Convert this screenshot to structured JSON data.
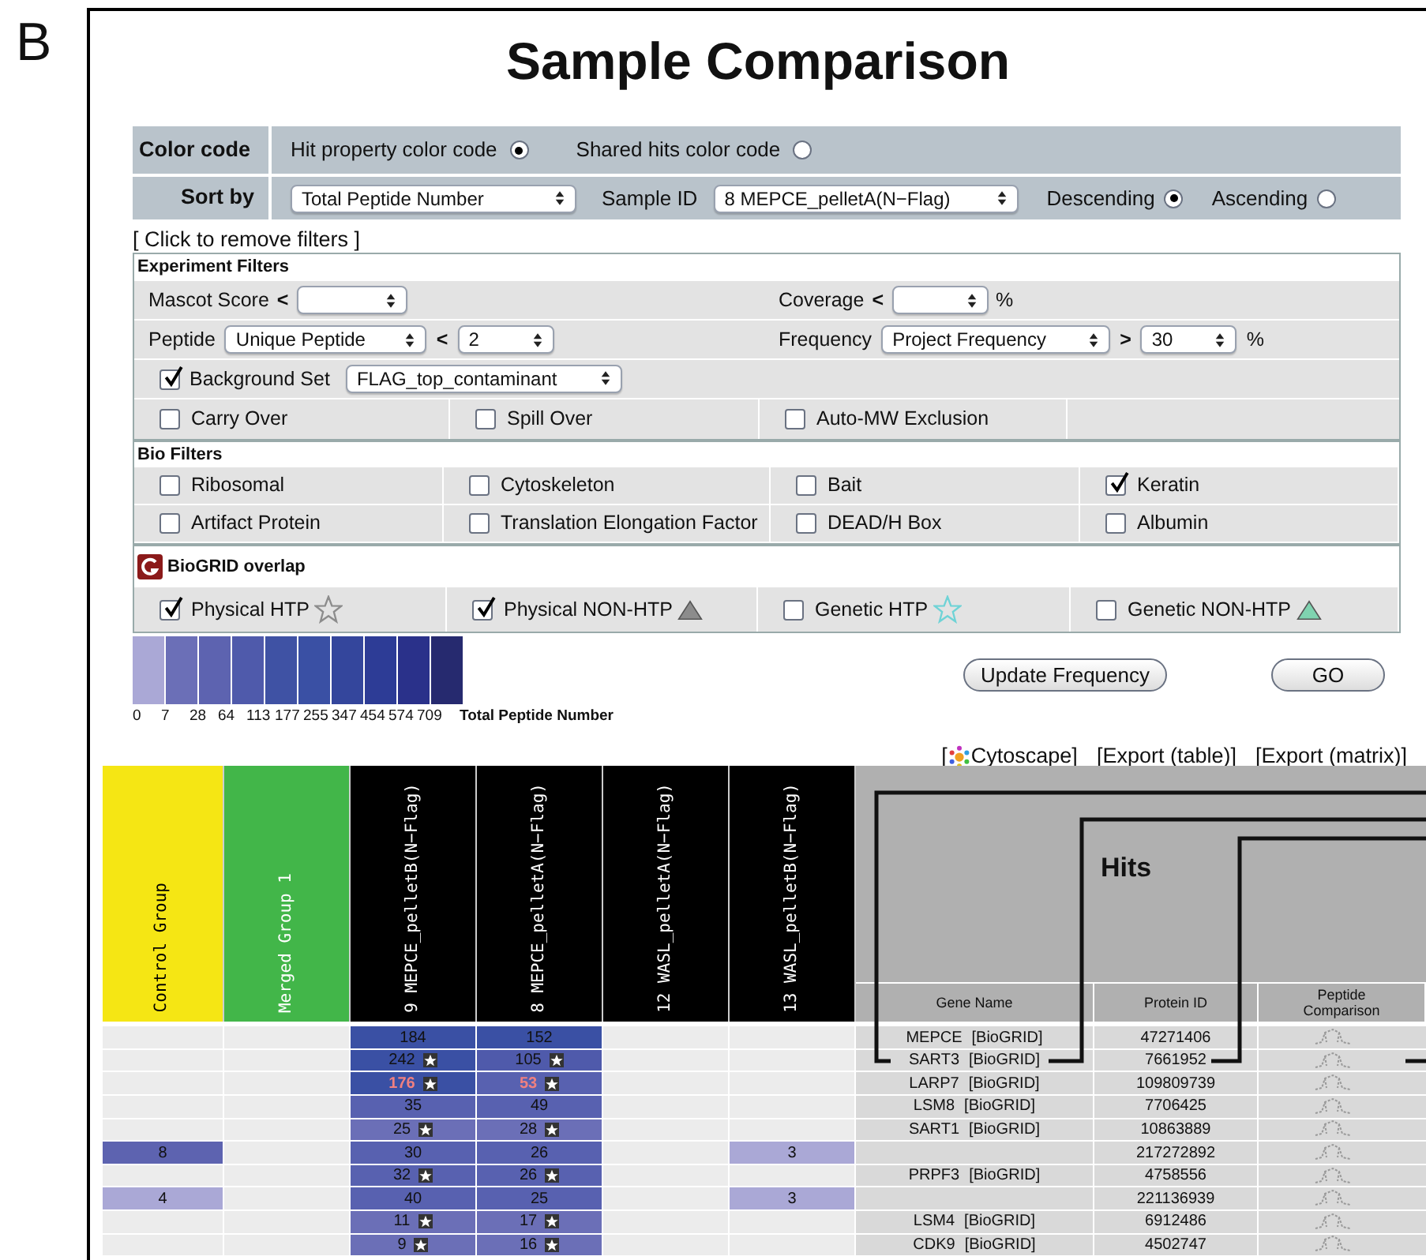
{
  "panel_label": "B",
  "title": "Sample Comparison",
  "color_code": {
    "label": "Color code",
    "options": [
      {
        "label": "Hit property color code",
        "selected": true
      },
      {
        "label": "Shared hits color code",
        "selected": false
      }
    ]
  },
  "sort_by": {
    "label": "Sort by",
    "field": "Total Peptide Number",
    "sample_label": "Sample ID",
    "sample": "8  MEPCE_pelletA(N−Flag)",
    "orders": [
      {
        "label": "Descending",
        "selected": true
      },
      {
        "label": "Ascending",
        "selected": false
      }
    ]
  },
  "remove_filters_link": "[ Click to remove filters ]",
  "experiment_filters": {
    "title": "Experiment Filters",
    "mascot": {
      "label": "Mascot Score",
      "op": "<"
    },
    "coverage": {
      "label": "Coverage",
      "op": "<",
      "unit": "%"
    },
    "peptide": {
      "label": "Peptide",
      "select": "Unique Peptide",
      "op": "<",
      "value": "2"
    },
    "frequency": {
      "label": "Frequency",
      "select": "Project Frequency",
      "op": ">",
      "value": "30",
      "unit": "%"
    },
    "background": {
      "label": "Background Set",
      "checked": true,
      "select": "FLAG_top_contaminant"
    },
    "checks": [
      {
        "label": "Carry Over",
        "checked": false
      },
      {
        "label": "Spill Over",
        "checked": false
      },
      {
        "label": "Auto-MW Exclusion",
        "checked": false
      }
    ]
  },
  "bio_filters": {
    "title": "Bio Filters",
    "items": [
      {
        "label": "Ribosomal",
        "checked": false
      },
      {
        "label": "Cytoskeleton",
        "checked": false
      },
      {
        "label": "Bait",
        "checked": false
      },
      {
        "label": "Keratin",
        "checked": true
      },
      {
        "label": "Artifact Protein",
        "checked": false
      },
      {
        "label": "Translation Elongation Factor",
        "checked": false
      },
      {
        "label": "DEAD/H Box",
        "checked": false
      },
      {
        "label": "Albumin",
        "checked": false
      }
    ]
  },
  "biogrid": {
    "title": "BioGRID overlap",
    "items": [
      {
        "label": "Physical HTP",
        "checked": true,
        "kind": "star",
        "color": "#8c8c8c"
      },
      {
        "label": "Physical NON-HTP",
        "checked": true,
        "kind": "triangle",
        "color": "#8c8c8c"
      },
      {
        "label": "Genetic HTP",
        "checked": false,
        "kind": "star",
        "color": "#6fd3d6"
      },
      {
        "label": "Genetic NON-HTP",
        "checked": false,
        "kind": "triangle",
        "color": "#7fd3b0"
      }
    ]
  },
  "legend": {
    "title": "Total Peptide Number",
    "swatches": [
      {
        "color": "#aaa8d6"
      },
      {
        "color": "#6b6fb7"
      },
      {
        "color": "#5d63b0"
      },
      {
        "color": "#4f5aab"
      },
      {
        "color": "#3f52a4"
      },
      {
        "color": "#3a50a4"
      },
      {
        "color": "#34469c"
      },
      {
        "color": "#2d3c96"
      },
      {
        "color": "#2a318a"
      },
      {
        "color": "#262a6f"
      }
    ],
    "ticks": [
      "0",
      "7",
      "28",
      "64",
      "113",
      "177",
      "255",
      "347",
      "454",
      "574",
      "709"
    ]
  },
  "buttons": [
    {
      "label": "Update Frequency"
    },
    {
      "label": "GO"
    }
  ],
  "export_links": [
    {
      "open": "[",
      "label": "Cytoscape]"
    },
    {
      "label": "[Export (table)]"
    },
    {
      "label": "[Export (matrix)]"
    }
  ],
  "table": {
    "sample_columns": [
      {
        "label": "Control Group",
        "kind": "control"
      },
      {
        "label": "Merged Group 1",
        "kind": "merged"
      },
      {
        "label": "9 MEPCE_pelletB(N−Flag)",
        "kind": "sample"
      },
      {
        "label": "8 MEPCE_pelletA(N−Flag)",
        "kind": "sample"
      },
      {
        "label": "12 WASL_pelletA(N−Flag)",
        "kind": "sample"
      },
      {
        "label": "13 WASL_pelletB(N−Flag)",
        "kind": "sample"
      }
    ],
    "hits_title": "Hits",
    "hit_columns": [
      "Gene Name",
      "Protein ID",
      "Peptide Comparison"
    ],
    "rows": [
      {
        "cells": [
          null,
          null,
          {
            "value": "184",
            "color": "#3a50a4",
            "star": false,
            "flagged": false
          },
          {
            "value": "152",
            "color": "#3a50a4",
            "star": false,
            "flagged": false
          },
          null,
          null
        ],
        "gene": "MEPCE",
        "biogrid": "[BioGRID]",
        "protein_id": "47271406"
      },
      {
        "cells": [
          null,
          null,
          {
            "value": "242",
            "color": "#3a50a4",
            "star": true,
            "flagged": false
          },
          {
            "value": "105",
            "color": "#4f5aab",
            "star": true,
            "flagged": false
          },
          null,
          null
        ],
        "gene": "SART3",
        "biogrid": "[BioGRID]",
        "protein_id": "7661952"
      },
      {
        "cells": [
          null,
          null,
          {
            "value": "176",
            "color": "#3a50a4",
            "star": true,
            "flagged": true
          },
          {
            "value": "53",
            "color": "#5861b0",
            "star": true,
            "flagged": true
          },
          null,
          null
        ],
        "gene": "LARP7",
        "biogrid": "[BioGRID]",
        "protein_id": "109809739"
      },
      {
        "cells": [
          null,
          null,
          {
            "value": "35",
            "color": "#5861b0",
            "star": false,
            "flagged": false
          },
          {
            "value": "49",
            "color": "#5861b0",
            "star": false,
            "flagged": false
          },
          null,
          null
        ],
        "gene": "LSM8",
        "biogrid": "[BioGRID]",
        "protein_id": "7706425"
      },
      {
        "cells": [
          null,
          null,
          {
            "value": "25",
            "color": "#6b6fb7",
            "star": true,
            "flagged": false
          },
          {
            "value": "28",
            "color": "#6b6fb7",
            "star": true,
            "flagged": false
          },
          null,
          null
        ],
        "gene": "SART1",
        "biogrid": "[BioGRID]",
        "protein_id": "10863889"
      },
      {
        "cells": [
          {
            "value": "8",
            "color": "#5d63b0",
            "star": false,
            "flagged": false
          },
          null,
          {
            "value": "30",
            "color": "#5861b0",
            "star": false,
            "flagged": false
          },
          {
            "value": "26",
            "color": "#5861b0",
            "star": false,
            "flagged": false
          },
          null,
          {
            "value": "3",
            "color": "#aaa8d6",
            "star": false,
            "flagged": false
          }
        ],
        "protein_id": "217272892"
      },
      {
        "cells": [
          null,
          null,
          {
            "value": "32",
            "color": "#5861b0",
            "star": true,
            "flagged": false
          },
          {
            "value": "26",
            "color": "#5861b0",
            "star": true,
            "flagged": false
          },
          null,
          null
        ],
        "gene": "PRPF3",
        "biogrid": "[BioGRID]",
        "protein_id": "4758556"
      },
      {
        "cells": [
          {
            "value": "4",
            "color": "#aaa8d6",
            "star": false,
            "flagged": false
          },
          null,
          {
            "value": "40",
            "color": "#5861b0",
            "star": false,
            "flagged": false
          },
          {
            "value": "25",
            "color": "#5861b0",
            "star": false,
            "flagged": false
          },
          null,
          {
            "value": "3",
            "color": "#aaa8d6",
            "star": false,
            "flagged": false
          }
        ],
        "protein_id": "221136939"
      },
      {
        "cells": [
          null,
          null,
          {
            "value": "11",
            "color": "#6b6fb7",
            "star": true,
            "flagged": false
          },
          {
            "value": "17",
            "color": "#6b6fb7",
            "star": true,
            "flagged": false
          },
          null,
          null
        ],
        "gene": "LSM4",
        "biogrid": "[BioGRID]",
        "protein_id": "6912486"
      },
      {
        "cells": [
          null,
          null,
          {
            "value": "9",
            "color": "#6b6fb7",
            "star": true,
            "flagged": false
          },
          {
            "value": "16",
            "color": "#6b6fb7",
            "star": true,
            "flagged": false
          },
          null,
          null
        ],
        "gene": "CDK9",
        "biogrid": "[BioGRID]",
        "protein_id": "4502747"
      }
    ]
  }
}
